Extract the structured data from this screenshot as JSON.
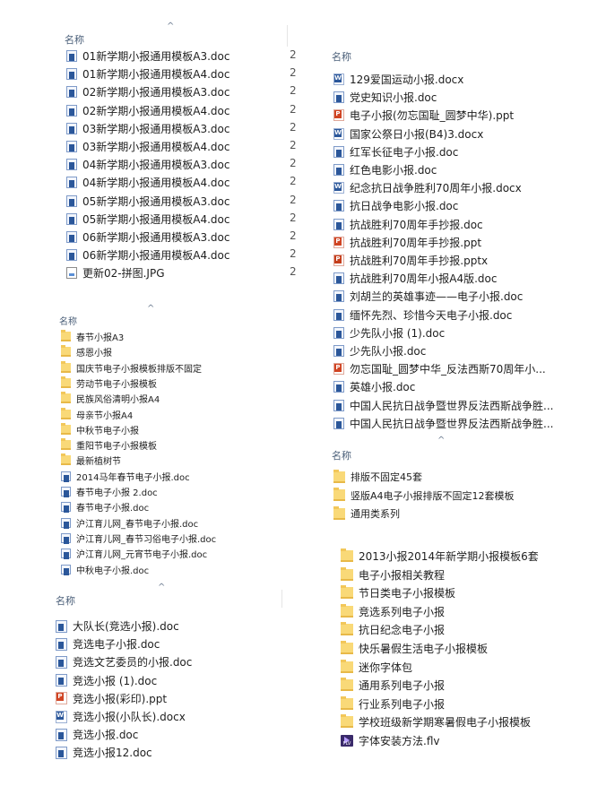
{
  "header_label": "名称",
  "panel_a": {
    "files": [
      {
        "icon": "doc",
        "name": "01新学期小报通用模板A3.doc",
        "col": "2"
      },
      {
        "icon": "doc",
        "name": "01新学期小报通用模板A4.doc",
        "col": "2"
      },
      {
        "icon": "doc",
        "name": "02新学期小报通用模板A3.doc",
        "col": "2"
      },
      {
        "icon": "doc",
        "name": "02新学期小报通用模板A4.doc",
        "col": "2"
      },
      {
        "icon": "doc",
        "name": "03新学期小报通用模板A3.doc",
        "col": "2"
      },
      {
        "icon": "doc",
        "name": "03新学期小报通用模板A4.doc",
        "col": "2"
      },
      {
        "icon": "doc",
        "name": "04新学期小报通用模板A3.doc",
        "col": "2"
      },
      {
        "icon": "doc",
        "name": "04新学期小报通用模板A4.doc",
        "col": "2"
      },
      {
        "icon": "doc",
        "name": "05新学期小报通用模板A3.doc",
        "col": "2"
      },
      {
        "icon": "doc",
        "name": "05新学期小报通用模板A4.doc",
        "col": "2"
      },
      {
        "icon": "doc",
        "name": "06新学期小报通用模板A3.doc",
        "col": "2"
      },
      {
        "icon": "doc",
        "name": "06新学期小报通用模板A4.doc",
        "col": "2"
      },
      {
        "icon": "jpg",
        "name": "更新02-拼图.JPG",
        "col": "2"
      }
    ]
  },
  "panel_b": {
    "files": [
      {
        "icon": "folder",
        "name": "春节小报A3"
      },
      {
        "icon": "folder",
        "name": "感恩小报"
      },
      {
        "icon": "folder",
        "name": "国庆节电子小报模板排版不固定"
      },
      {
        "icon": "folder",
        "name": "劳动节电子小报模板"
      },
      {
        "icon": "folder",
        "name": "民族风俗清明小报A4"
      },
      {
        "icon": "folder",
        "name": "母亲节小报A4"
      },
      {
        "icon": "folder",
        "name": "中秋节电子小报"
      },
      {
        "icon": "folder",
        "name": "重阳节电子小报模板"
      },
      {
        "icon": "folder",
        "name": "最新植树节"
      },
      {
        "icon": "doc",
        "name": "2014马年春节电子小报.doc"
      },
      {
        "icon": "doc",
        "name": "春节电子小报 2.doc"
      },
      {
        "icon": "doc",
        "name": "春节电子小报.doc"
      },
      {
        "icon": "doc",
        "name": "沪江育儿网_春节电子小报.doc"
      },
      {
        "icon": "doc",
        "name": "沪江育儿网_春节习俗电子小报.doc"
      },
      {
        "icon": "doc",
        "name": "沪江育儿网_元宵节电子小报.doc"
      },
      {
        "icon": "doc",
        "name": "中秋电子小报.doc"
      }
    ]
  },
  "panel_c": {
    "files": [
      {
        "icon": "doc",
        "name": "大队长(竞选小报).doc"
      },
      {
        "icon": "doc",
        "name": "竞选电子小报.doc"
      },
      {
        "icon": "doc",
        "name": "竞选文艺委员的小报.doc"
      },
      {
        "icon": "doc",
        "name": "竞选小报 (1).doc"
      },
      {
        "icon": "ppt",
        "name": "竞选小报(彩印).ppt"
      },
      {
        "icon": "docx",
        "name": "竞选小报(小队长).docx"
      },
      {
        "icon": "doc",
        "name": "竞选小报.doc"
      },
      {
        "icon": "doc",
        "name": "竞选小报12.doc"
      }
    ]
  },
  "panel_d": {
    "files": [
      {
        "icon": "docx",
        "name": "129爱国运动小报.docx"
      },
      {
        "icon": "doc",
        "name": "党史知识小报.doc"
      },
      {
        "icon": "ppt",
        "name": "电子小报(勿忘国耻_圆梦中华).ppt"
      },
      {
        "icon": "docx",
        "name": "国家公祭日小报(B4)3.docx"
      },
      {
        "icon": "doc",
        "name": "红军长征电子小报.doc"
      },
      {
        "icon": "doc",
        "name": "红色电影小报.doc"
      },
      {
        "icon": "docx",
        "name": "纪念抗日战争胜利70周年小报.docx"
      },
      {
        "icon": "doc",
        "name": "抗日战争电影小报.doc"
      },
      {
        "icon": "doc",
        "name": "抗战胜利70周年手抄报.doc"
      },
      {
        "icon": "ppt",
        "name": "抗战胜利70周年手抄报.ppt"
      },
      {
        "icon": "pptx",
        "name": "抗战胜利70周年手抄报.pptx"
      },
      {
        "icon": "doc",
        "name": "抗战胜利70周年小报A4版.doc"
      },
      {
        "icon": "doc",
        "name": "刘胡兰的英雄事迹——电子小报.doc"
      },
      {
        "icon": "doc",
        "name": "缅怀先烈、珍惜今天电子小报.doc"
      },
      {
        "icon": "doc",
        "name": "少先队小报 (1).doc"
      },
      {
        "icon": "doc",
        "name": "少先队小报.doc"
      },
      {
        "icon": "ppt",
        "name": "勿忘国耻_圆梦中华_反法西斯70周年小..."
      },
      {
        "icon": "doc",
        "name": "英雄小报.doc"
      },
      {
        "icon": "doc",
        "name": "中国人民抗日战争暨世界反法西斯战争胜..."
      },
      {
        "icon": "doc",
        "name": "中国人民抗日战争暨世界反法西斯战争胜..."
      }
    ]
  },
  "panel_e": {
    "files": [
      {
        "icon": "folder",
        "name": "排版不固定45套"
      },
      {
        "icon": "folder",
        "name": "竖版A4电子小报排版不固定12套模板"
      },
      {
        "icon": "folder",
        "name": "通用类系列"
      }
    ]
  },
  "panel_f": {
    "files": [
      {
        "icon": "folder",
        "name": "2013小报2014年新学期小报模板6套"
      },
      {
        "icon": "folder",
        "name": "电子小报相关教程"
      },
      {
        "icon": "folder",
        "name": "节日类电子小报模板"
      },
      {
        "icon": "folder",
        "name": "竞选系列电子小报"
      },
      {
        "icon": "folder",
        "name": "抗日纪念电子小报"
      },
      {
        "icon": "folder",
        "name": "快乐暑假生活电子小报模板"
      },
      {
        "icon": "folder",
        "name": "迷你字体包"
      },
      {
        "icon": "folder",
        "name": "通用系列电子小报"
      },
      {
        "icon": "folder",
        "name": "行业系列电子小报"
      },
      {
        "icon": "folder",
        "name": "学校班级新学期寒暑假电子小报模板"
      },
      {
        "icon": "flv",
        "name": "字体安装方法.flv"
      }
    ]
  }
}
